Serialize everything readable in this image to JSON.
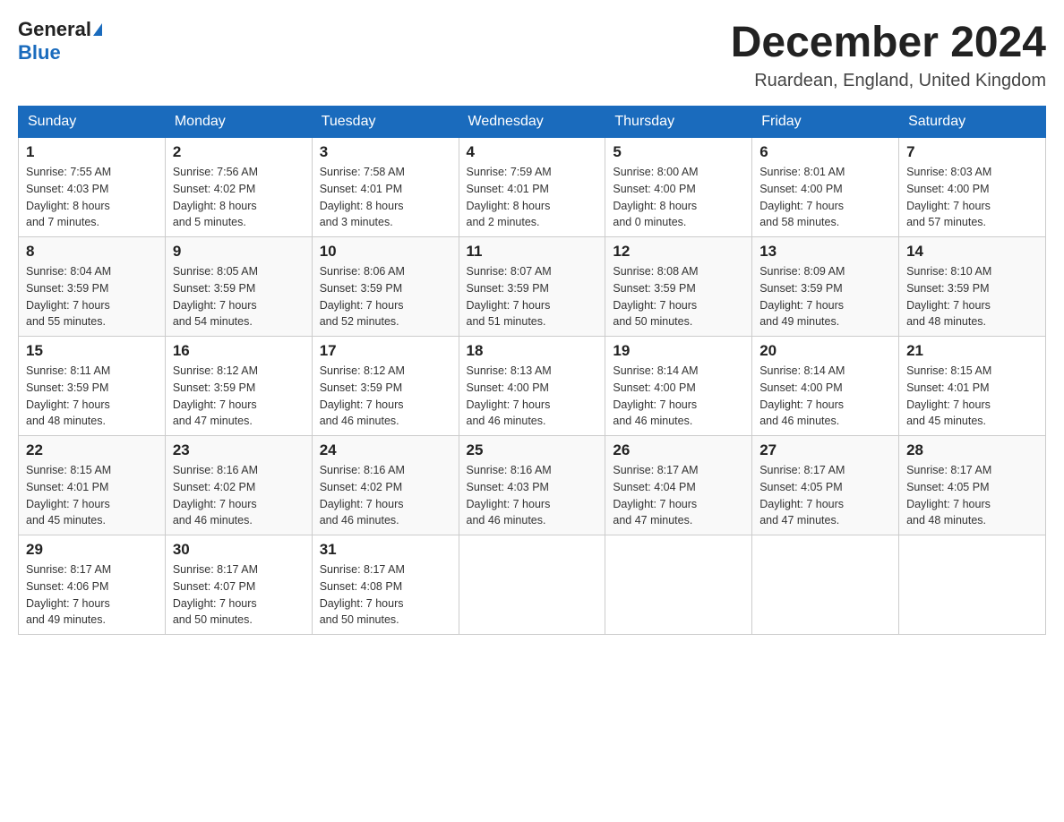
{
  "header": {
    "logo_general": "General",
    "logo_blue": "Blue",
    "month_title": "December 2024",
    "location": "Ruardean, England, United Kingdom"
  },
  "columns": [
    "Sunday",
    "Monday",
    "Tuesday",
    "Wednesday",
    "Thursday",
    "Friday",
    "Saturday"
  ],
  "weeks": [
    [
      {
        "day": "1",
        "sunrise": "Sunrise: 7:55 AM",
        "sunset": "Sunset: 4:03 PM",
        "daylight": "Daylight: 8 hours",
        "daylight2": "and 7 minutes."
      },
      {
        "day": "2",
        "sunrise": "Sunrise: 7:56 AM",
        "sunset": "Sunset: 4:02 PM",
        "daylight": "Daylight: 8 hours",
        "daylight2": "and 5 minutes."
      },
      {
        "day": "3",
        "sunrise": "Sunrise: 7:58 AM",
        "sunset": "Sunset: 4:01 PM",
        "daylight": "Daylight: 8 hours",
        "daylight2": "and 3 minutes."
      },
      {
        "day": "4",
        "sunrise": "Sunrise: 7:59 AM",
        "sunset": "Sunset: 4:01 PM",
        "daylight": "Daylight: 8 hours",
        "daylight2": "and 2 minutes."
      },
      {
        "day": "5",
        "sunrise": "Sunrise: 8:00 AM",
        "sunset": "Sunset: 4:00 PM",
        "daylight": "Daylight: 8 hours",
        "daylight2": "and 0 minutes."
      },
      {
        "day": "6",
        "sunrise": "Sunrise: 8:01 AM",
        "sunset": "Sunset: 4:00 PM",
        "daylight": "Daylight: 7 hours",
        "daylight2": "and 58 minutes."
      },
      {
        "day": "7",
        "sunrise": "Sunrise: 8:03 AM",
        "sunset": "Sunset: 4:00 PM",
        "daylight": "Daylight: 7 hours",
        "daylight2": "and 57 minutes."
      }
    ],
    [
      {
        "day": "8",
        "sunrise": "Sunrise: 8:04 AM",
        "sunset": "Sunset: 3:59 PM",
        "daylight": "Daylight: 7 hours",
        "daylight2": "and 55 minutes."
      },
      {
        "day": "9",
        "sunrise": "Sunrise: 8:05 AM",
        "sunset": "Sunset: 3:59 PM",
        "daylight": "Daylight: 7 hours",
        "daylight2": "and 54 minutes."
      },
      {
        "day": "10",
        "sunrise": "Sunrise: 8:06 AM",
        "sunset": "Sunset: 3:59 PM",
        "daylight": "Daylight: 7 hours",
        "daylight2": "and 52 minutes."
      },
      {
        "day": "11",
        "sunrise": "Sunrise: 8:07 AM",
        "sunset": "Sunset: 3:59 PM",
        "daylight": "Daylight: 7 hours",
        "daylight2": "and 51 minutes."
      },
      {
        "day": "12",
        "sunrise": "Sunrise: 8:08 AM",
        "sunset": "Sunset: 3:59 PM",
        "daylight": "Daylight: 7 hours",
        "daylight2": "and 50 minutes."
      },
      {
        "day": "13",
        "sunrise": "Sunrise: 8:09 AM",
        "sunset": "Sunset: 3:59 PM",
        "daylight": "Daylight: 7 hours",
        "daylight2": "and 49 minutes."
      },
      {
        "day": "14",
        "sunrise": "Sunrise: 8:10 AM",
        "sunset": "Sunset: 3:59 PM",
        "daylight": "Daylight: 7 hours",
        "daylight2": "and 48 minutes."
      }
    ],
    [
      {
        "day": "15",
        "sunrise": "Sunrise: 8:11 AM",
        "sunset": "Sunset: 3:59 PM",
        "daylight": "Daylight: 7 hours",
        "daylight2": "and 48 minutes."
      },
      {
        "day": "16",
        "sunrise": "Sunrise: 8:12 AM",
        "sunset": "Sunset: 3:59 PM",
        "daylight": "Daylight: 7 hours",
        "daylight2": "and 47 minutes."
      },
      {
        "day": "17",
        "sunrise": "Sunrise: 8:12 AM",
        "sunset": "Sunset: 3:59 PM",
        "daylight": "Daylight: 7 hours",
        "daylight2": "and 46 minutes."
      },
      {
        "day": "18",
        "sunrise": "Sunrise: 8:13 AM",
        "sunset": "Sunset: 4:00 PM",
        "daylight": "Daylight: 7 hours",
        "daylight2": "and 46 minutes."
      },
      {
        "day": "19",
        "sunrise": "Sunrise: 8:14 AM",
        "sunset": "Sunset: 4:00 PM",
        "daylight": "Daylight: 7 hours",
        "daylight2": "and 46 minutes."
      },
      {
        "day": "20",
        "sunrise": "Sunrise: 8:14 AM",
        "sunset": "Sunset: 4:00 PM",
        "daylight": "Daylight: 7 hours",
        "daylight2": "and 46 minutes."
      },
      {
        "day": "21",
        "sunrise": "Sunrise: 8:15 AM",
        "sunset": "Sunset: 4:01 PM",
        "daylight": "Daylight: 7 hours",
        "daylight2": "and 45 minutes."
      }
    ],
    [
      {
        "day": "22",
        "sunrise": "Sunrise: 8:15 AM",
        "sunset": "Sunset: 4:01 PM",
        "daylight": "Daylight: 7 hours",
        "daylight2": "and 45 minutes."
      },
      {
        "day": "23",
        "sunrise": "Sunrise: 8:16 AM",
        "sunset": "Sunset: 4:02 PM",
        "daylight": "Daylight: 7 hours",
        "daylight2": "and 46 minutes."
      },
      {
        "day": "24",
        "sunrise": "Sunrise: 8:16 AM",
        "sunset": "Sunset: 4:02 PM",
        "daylight": "Daylight: 7 hours",
        "daylight2": "and 46 minutes."
      },
      {
        "day": "25",
        "sunrise": "Sunrise: 8:16 AM",
        "sunset": "Sunset: 4:03 PM",
        "daylight": "Daylight: 7 hours",
        "daylight2": "and 46 minutes."
      },
      {
        "day": "26",
        "sunrise": "Sunrise: 8:17 AM",
        "sunset": "Sunset: 4:04 PM",
        "daylight": "Daylight: 7 hours",
        "daylight2": "and 47 minutes."
      },
      {
        "day": "27",
        "sunrise": "Sunrise: 8:17 AM",
        "sunset": "Sunset: 4:05 PM",
        "daylight": "Daylight: 7 hours",
        "daylight2": "and 47 minutes."
      },
      {
        "day": "28",
        "sunrise": "Sunrise: 8:17 AM",
        "sunset": "Sunset: 4:05 PM",
        "daylight": "Daylight: 7 hours",
        "daylight2": "and 48 minutes."
      }
    ],
    [
      {
        "day": "29",
        "sunrise": "Sunrise: 8:17 AM",
        "sunset": "Sunset: 4:06 PM",
        "daylight": "Daylight: 7 hours",
        "daylight2": "and 49 minutes."
      },
      {
        "day": "30",
        "sunrise": "Sunrise: 8:17 AM",
        "sunset": "Sunset: 4:07 PM",
        "daylight": "Daylight: 7 hours",
        "daylight2": "and 50 minutes."
      },
      {
        "day": "31",
        "sunrise": "Sunrise: 8:17 AM",
        "sunset": "Sunset: 4:08 PM",
        "daylight": "Daylight: 7 hours",
        "daylight2": "and 50 minutes."
      },
      null,
      null,
      null,
      null
    ]
  ]
}
